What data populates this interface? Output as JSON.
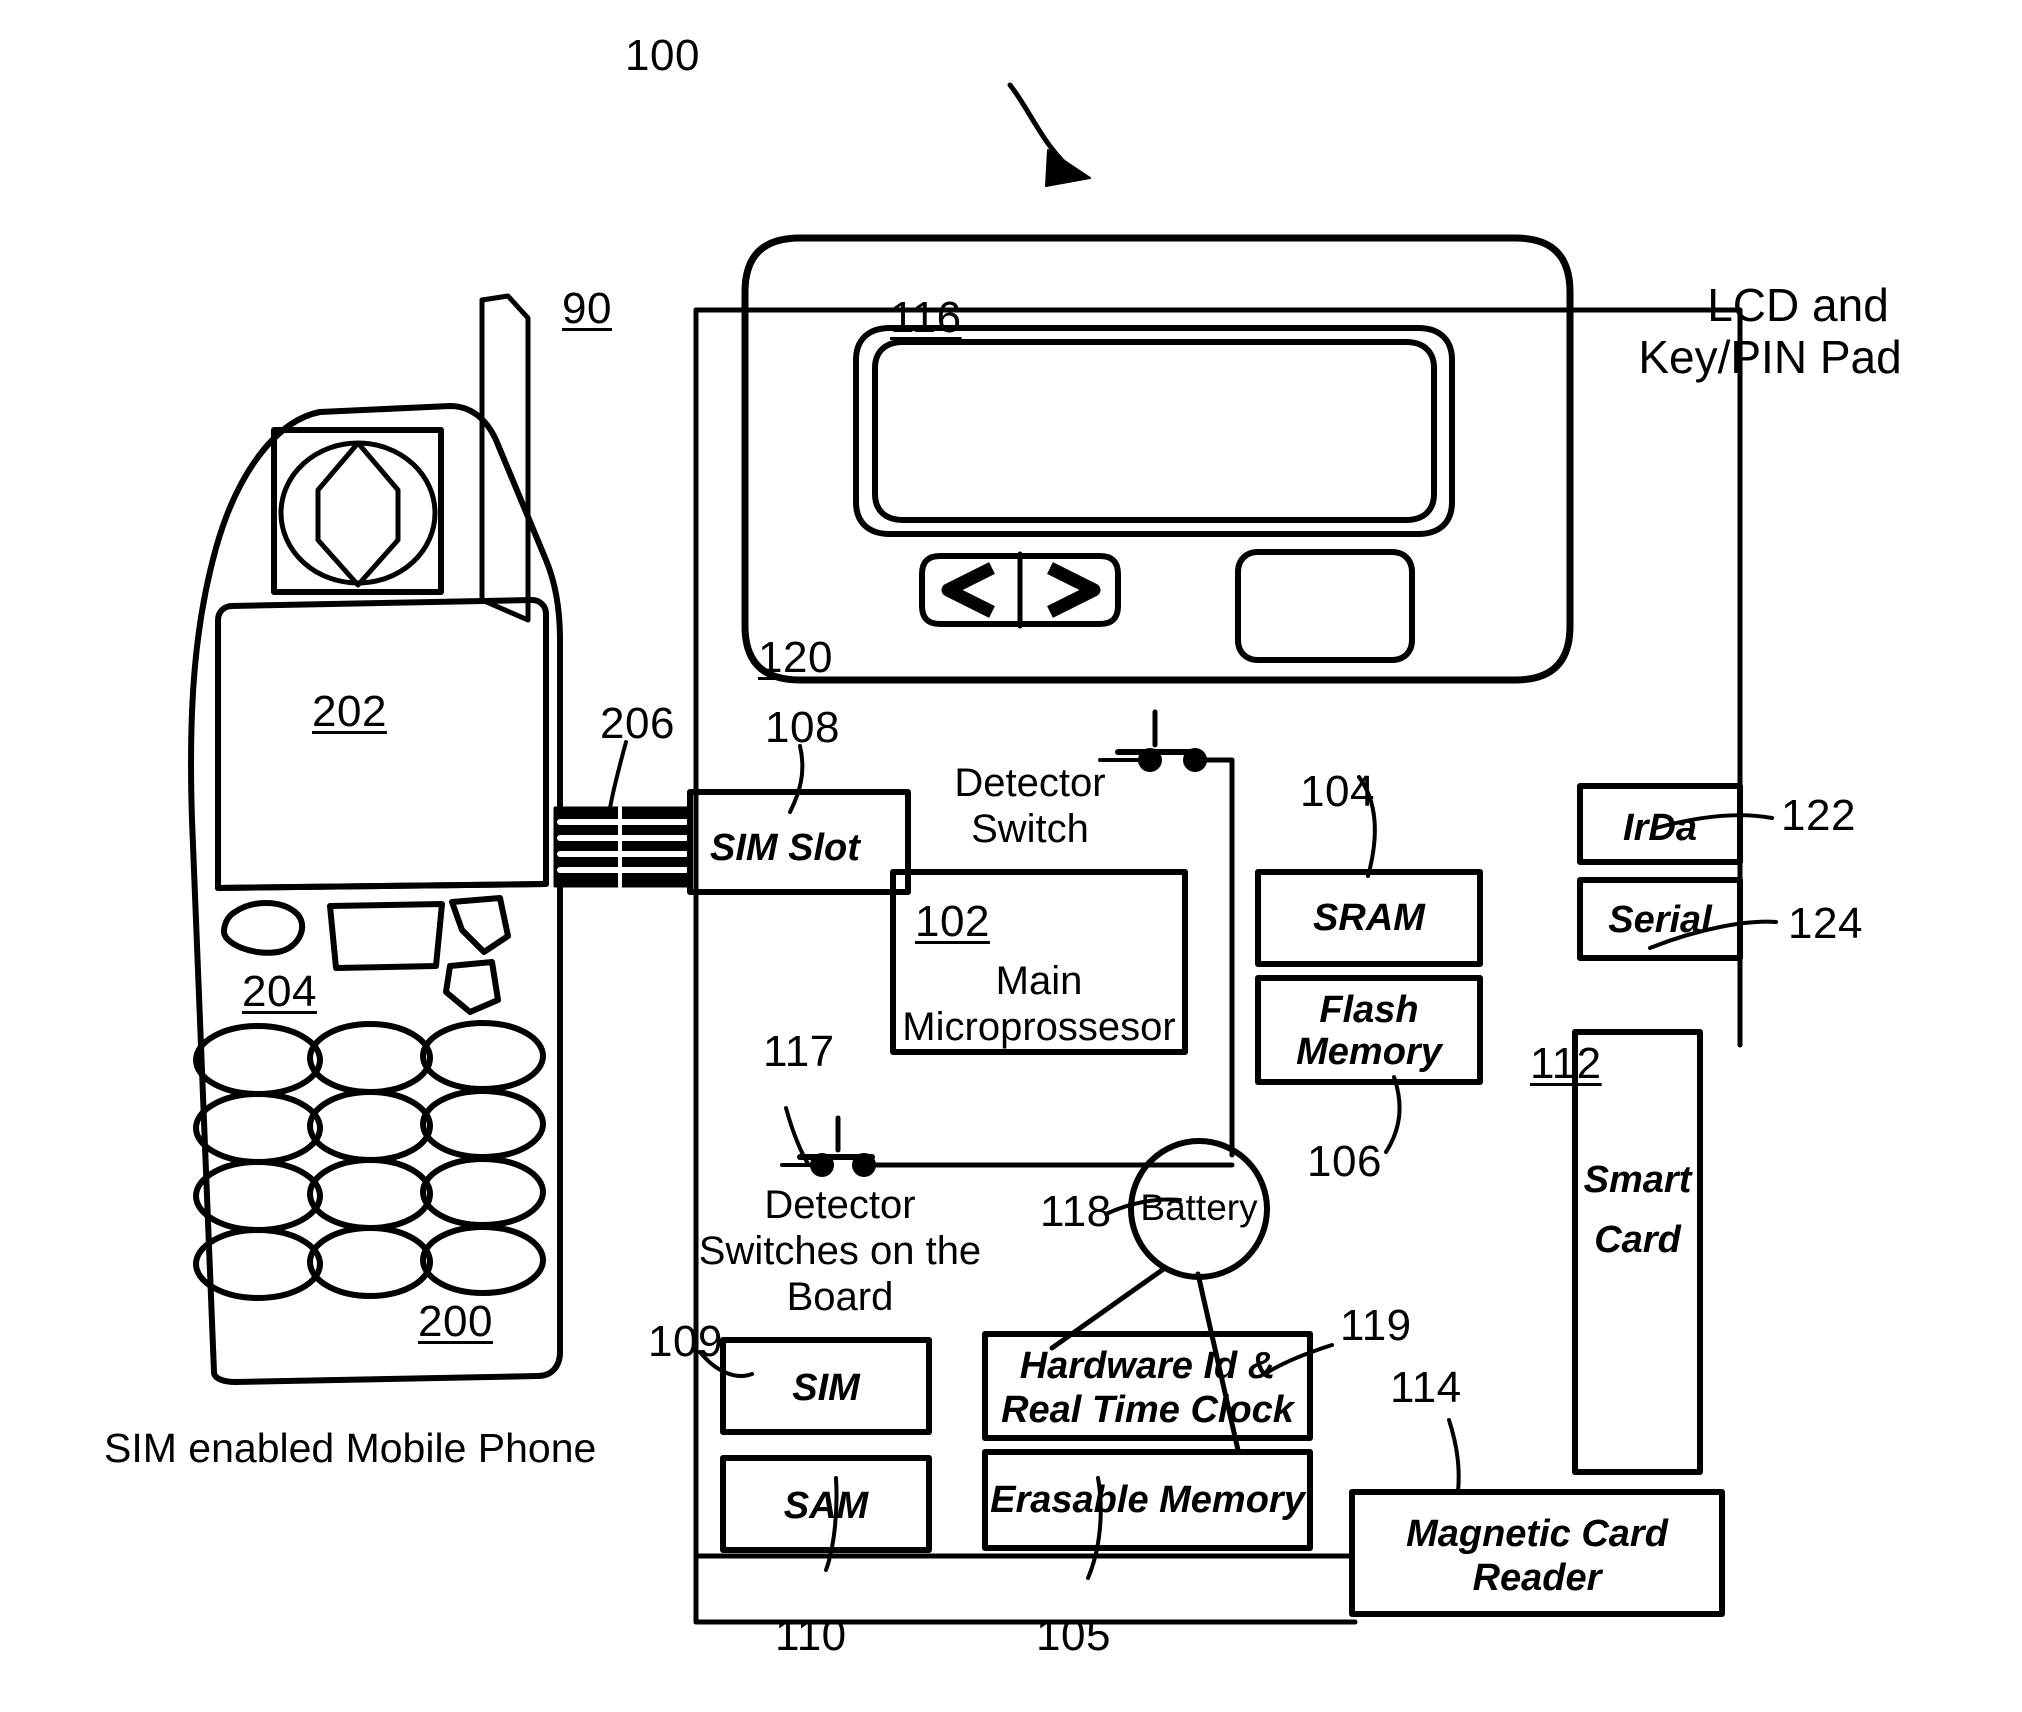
{
  "figure": {
    "title_ref": "100",
    "caption": "SIM enabled Mobile Phone",
    "device_ref": "90",
    "lcd_keypad_label": "LCD and\nKey/PIN Pad"
  },
  "phone": {
    "ref": "200",
    "screen_ref": "202",
    "keypad_ref": "204",
    "connector_ref": "206"
  },
  "device": {
    "display_ref": "116",
    "nav_keys_ref": "120",
    "nav_left": "<",
    "nav_right": ">"
  },
  "blocks": [
    {
      "id": "sim_slot",
      "label": "SIM Slot",
      "ref": "108"
    },
    {
      "id": "cpu",
      "label": "Main\nMicroprossesor",
      "ref": "102"
    },
    {
      "id": "sram",
      "label": "SRAM",
      "ref": "104"
    },
    {
      "id": "flash",
      "label": "Flash\nMemory",
      "ref": "106"
    },
    {
      "id": "sim",
      "label": "SIM",
      "ref": "109"
    },
    {
      "id": "sam",
      "label": "SAM",
      "ref": "110"
    },
    {
      "id": "hwid_rtc",
      "label": "Hardware Id &\nReal Time Clock",
      "ref": "119"
    },
    {
      "id": "erasable",
      "label": "Erasable Memory",
      "ref": "105"
    },
    {
      "id": "magcard",
      "label": "Magnetic Card\nReader",
      "ref": "114"
    },
    {
      "id": "irda",
      "label": "IrDa",
      "ref": "122"
    },
    {
      "id": "serial",
      "label": "Serial",
      "ref": "124"
    },
    {
      "id": "smartcard",
      "label": "Smart\nCard",
      "ref": "112"
    },
    {
      "id": "battery",
      "label": "Battery",
      "ref": "118"
    }
  ],
  "switches": [
    {
      "id": "detector_switch_top",
      "label": "Detector\nSwitch",
      "ref": ""
    },
    {
      "id": "detector_switch_board",
      "label": "Detector\nSwitches on the\nBoard",
      "ref": "117"
    }
  ],
  "texts": {
    "cpu_line1": "Main",
    "cpu_line2": "Microprossesor",
    "flash_line1": "Flash",
    "flash_line2": "Memory",
    "hwid_line1": "Hardware Id &",
    "hwid_line2": "Real Time Clock",
    "magcard_line1": "Magnetic Card",
    "magcard_line2": "Reader",
    "smartcard_line1": "Smart",
    "smartcard_line2": "Card",
    "detector_switch_line1": "Detector",
    "detector_switch_line2": "Switch",
    "detector_board_line1": "Detector",
    "detector_board_line2": "Switches on the",
    "detector_board_line3": "Board",
    "lcd_line1": "LCD and",
    "lcd_line2": "Key/PIN Pad"
  },
  "colors": {
    "ink": "#000000",
    "paper": "#ffffff"
  }
}
